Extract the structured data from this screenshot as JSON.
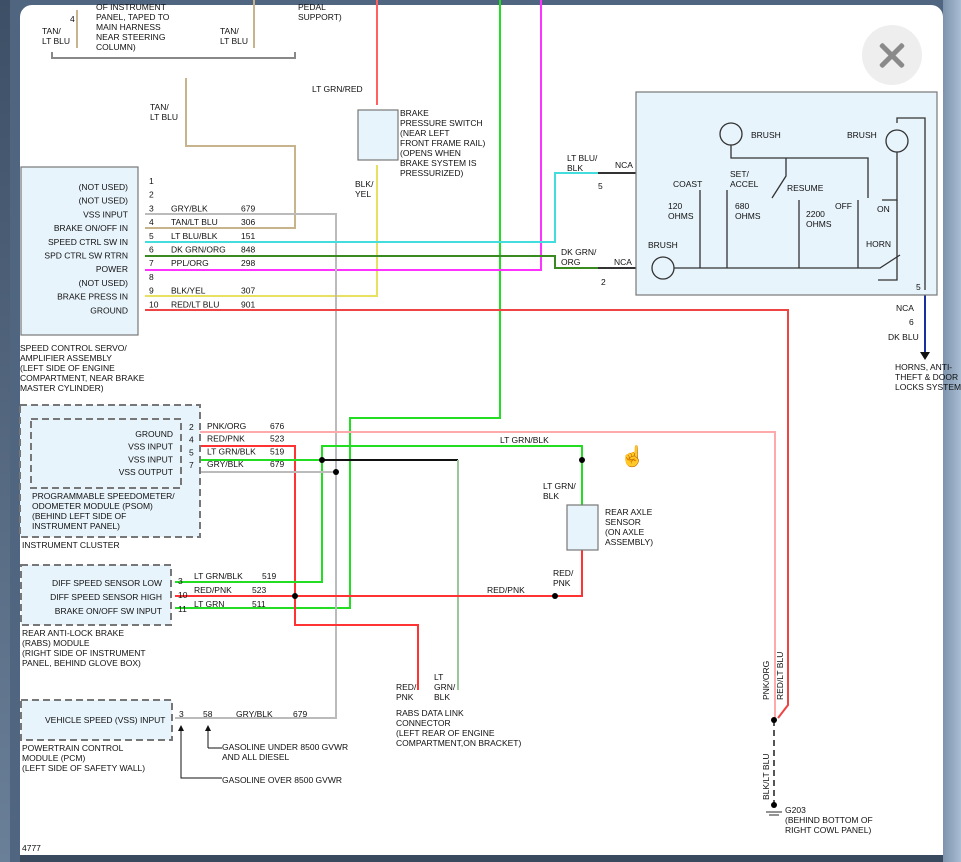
{
  "viewer": {
    "close_label": "close",
    "footer_code": "4777"
  },
  "colors": {
    "tan_lt_blu": "#c8b48c",
    "lt_grn_red": "#ff6060",
    "lt_grn": "#22dd22",
    "ppl_org": "#ff33ff",
    "lt_blu_blk": "#44dddd",
    "dk_grn_org": "#3a8a22",
    "gry_blk": "#bbbbbb",
    "blk_yel": "#e8e060",
    "red_lt_blu": "#ee4444",
    "pnk_org": "#ffaaaa",
    "red_pnk": "#ff3333",
    "dk_blu": "#1a2fa0",
    "box_fill": "#e8f4fc"
  },
  "top": {
    "harness_note": [
      "OF INSTRUMENT",
      "PANEL, TAPED TO",
      "MAIN HARNESS",
      "NEAR STEERING",
      "COLUMN)"
    ],
    "pin": "4",
    "wire_left": [
      "TAN/",
      "LT BLU"
    ],
    "wire_right": [
      "TAN/",
      "LT BLU"
    ],
    "pedal_note": [
      "PEDAL",
      "SUPPORT)"
    ],
    "wire_down": [
      "TAN/",
      "LT BLU"
    ]
  },
  "brake_switch": {
    "wire_top": "LT GRN/RED",
    "label": [
      "BRAKE",
      "PRESSURE SWITCH",
      "(NEAR LEFT",
      "FRONT FRAME RAIL)",
      "(OPENS WHEN",
      "BRAKE SYSTEM IS",
      "PRESSURIZED)"
    ],
    "wire_bottom": [
      "BLK/",
      "YEL"
    ]
  },
  "servo": {
    "pins": [
      {
        "label": "(NOT USED)",
        "pin": "1",
        "wire": "",
        "circuit": ""
      },
      {
        "label": "(NOT USED)",
        "pin": "2",
        "wire": "",
        "circuit": ""
      },
      {
        "label": "VSS INPUT",
        "pin": "3",
        "wire": "GRY/BLK",
        "circuit": "679"
      },
      {
        "label": "BRAKE ON/OFF IN",
        "pin": "4",
        "wire": "TAN/LT BLU",
        "circuit": "306"
      },
      {
        "label": "SPEED CTRL SW IN",
        "pin": "5",
        "wire": "LT BLU/BLK",
        "circuit": "151"
      },
      {
        "label": "SPD CTRL SW RTRN",
        "pin": "6",
        "wire": "DK GRN/ORG",
        "circuit": "848"
      },
      {
        "label": "POWER",
        "pin": "7",
        "wire": "PPL/ORG",
        "circuit": "298"
      },
      {
        "label": "(NOT USED)",
        "pin": "8",
        "wire": "",
        "circuit": ""
      },
      {
        "label": "BRAKE PRESS IN",
        "pin": "9",
        "wire": "BLK/YEL",
        "circuit": "307"
      },
      {
        "label": "GROUND",
        "pin": "10",
        "wire": "RED/LT BLU",
        "circuit": "901"
      }
    ],
    "title": [
      "SPEED CONTROL SERVO/",
      "AMPLIFIER ASSEMBLY",
      " (LEFT SIDE OF ENGINE",
      " COMPARTMENT, NEAR BRAKE",
      " MASTER CYLINDER)"
    ]
  },
  "switch_assembly": {
    "wire5": [
      "LT BLU/",
      "BLK"
    ],
    "nca": "NCA",
    "pin5": "5",
    "wire2": [
      "DK GRN/",
      "ORG"
    ],
    "pin2": "2",
    "brush": "BRUSH",
    "coast": "COAST",
    "set_accel": [
      "SET/",
      "ACCEL"
    ],
    "resume": "RESUME",
    "r120": [
      "120",
      "OHMS"
    ],
    "r680": [
      "680",
      "OHMS"
    ],
    "r2200": [
      "2200",
      "OHMS"
    ],
    "off": "OFF",
    "on": "ON",
    "horn": "HORN",
    "out_pin": "5",
    "out_nca": "NCA",
    "out_pin6": "6",
    "out_wire": "DK BLU",
    "out_dest": [
      "HORNS, ANTI-",
      "THEFT & DOOR",
      "LOCKS SYSTEM"
    ]
  },
  "psom": {
    "pins": [
      {
        "label": "GROUND",
        "pin": "2",
        "wire": "PNK/ORG",
        "circuit": "676"
      },
      {
        "label": "VSS INPUT",
        "pin": "4",
        "wire": "RED/PNK",
        "circuit": "523"
      },
      {
        "label": "VSS INPUT",
        "pin": "5",
        "wire": "LT GRN/BLK",
        "circuit": "519"
      },
      {
        "label": "VSS OUTPUT",
        "pin": "7",
        "wire": "GRY/BLK",
        "circuit": "679"
      }
    ],
    "title": [
      "PROGRAMMABLE SPEEDOMETER/",
      "ODOMETER MODULE (PSOM)",
      " (BEHIND LEFT SIDE OF",
      " INSTRUMENT PANEL)"
    ],
    "cluster": "INSTRUMENT CLUSTER"
  },
  "rabs": {
    "pins": [
      {
        "label": "DIFF SPEED SENSOR LOW",
        "pin": "3",
        "wire": "LT GRN/BLK",
        "circuit": "519"
      },
      {
        "label": "DIFF SPEED SENSOR HIGH",
        "pin": "10",
        "wire": "RED/PNK",
        "circuit": "523"
      },
      {
        "label": "BRAKE ON/OFF SW INPUT",
        "pin": "11",
        "wire": "LT GRN",
        "circuit": "511"
      }
    ],
    "title": [
      "REAR ANTI-LOCK BRAKE",
      "(RABS) MODULE",
      "(RIGHT SIDE OF INSTRUMENT",
      " PANEL, BEHIND GLOVE BOX)"
    ]
  },
  "sensor": {
    "wire_top_h": "LT GRN/BLK",
    "wire_top": [
      "LT GRN/",
      "BLK"
    ],
    "label": [
      "REAR AXLE",
      "SENSOR",
      "(ON AXLE",
      "ASSEMBLY)"
    ],
    "wire_bottom": [
      "RED/",
      "PNK"
    ],
    "wire_h": "RED/PNK"
  },
  "dlc": {
    "wire1": [
      "RED/",
      "PNK"
    ],
    "wire2": [
      "LT",
      "GRN/",
      "BLK"
    ],
    "label": [
      "RABS DATA LINK",
      "CONNECTOR",
      " (LEFT REAR OF ENGINE",
      " COMPARTMENT,ON BRACKET)"
    ]
  },
  "pcm": {
    "label": "VEHICLE SPEED (VSS) INPUT",
    "pin": "3",
    "pin_alt": "58",
    "wire": "GRY/BLK",
    "circuit": "679",
    "title": [
      "POWERTRAIN CONTROL",
      "MODULE (PCM)",
      " (LEFT SIDE OF SAFETY WALL)"
    ],
    "note_under": [
      "GASOLINE UNDER 8500 GVWR",
      "AND ALL DIESEL"
    ],
    "note_over": "GASOLINE OVER 8500 GVWR"
  },
  "ground": {
    "wire_pnk": "PNK/ORG",
    "wire_red": "RED/LT BLU",
    "wire_blk": "BLK/LT BLU",
    "label": [
      "G203",
      "(BEHIND BOTTOM OF",
      "RIGHT COWL PANEL)"
    ]
  }
}
